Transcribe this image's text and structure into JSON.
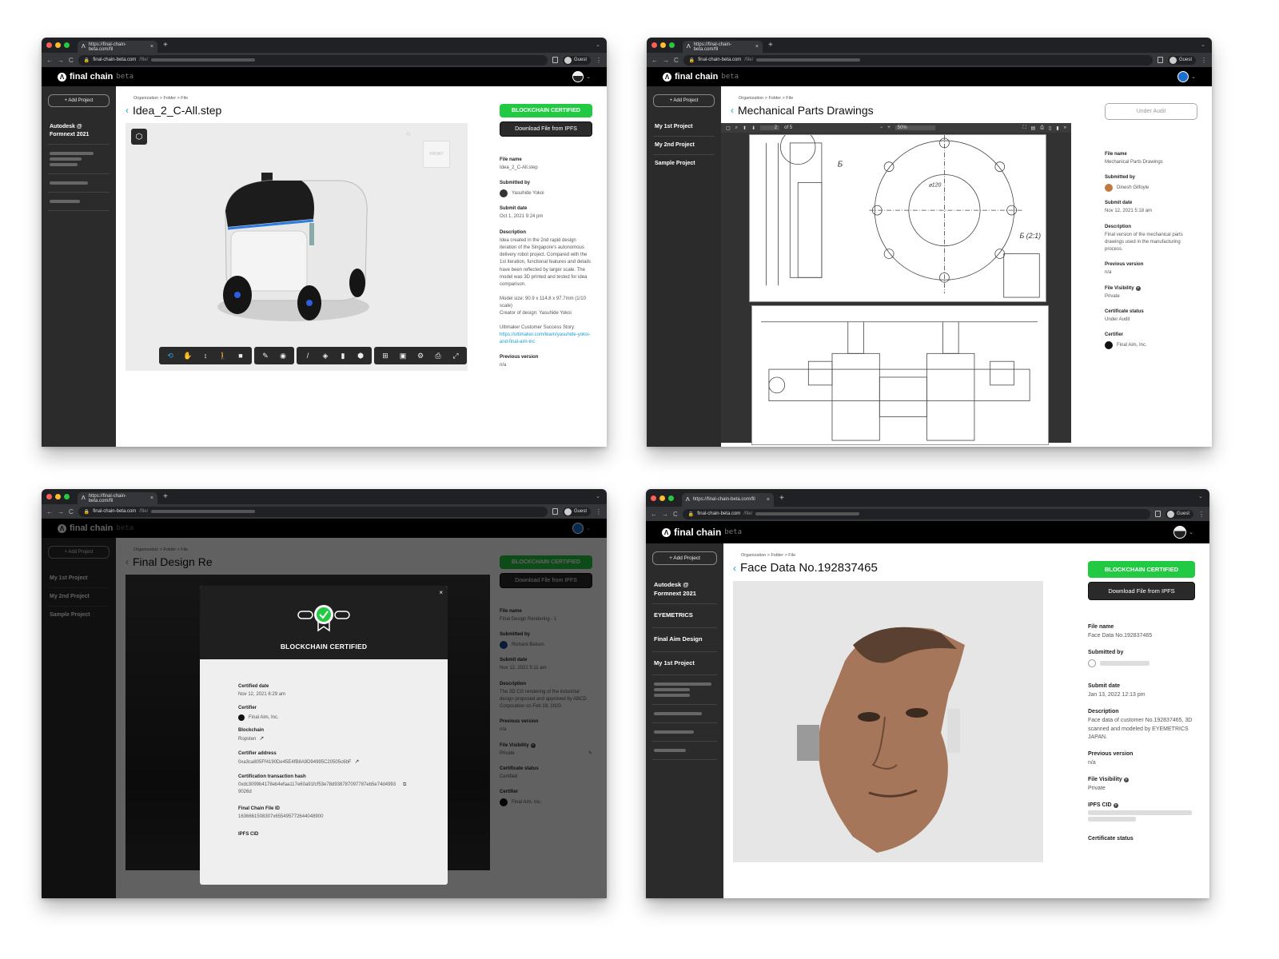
{
  "browser": {
    "tab_title": "https://final-chain-beta.com/fil",
    "url_host": "final-chain-beta.com",
    "url_path": "/file/",
    "profile_label": "Guest"
  },
  "app": {
    "brand": "final chain",
    "brand_suffix": "beta",
    "add_project_label": "+ Add Project",
    "breadcrumb": "Organization > Folder > File",
    "labels": {
      "file_name": "File name",
      "submitted_by": "Submitted by",
      "submit_date": "Submit date",
      "description": "Description",
      "previous_version": "Previous version",
      "file_visibility": "File Visibility",
      "certificate_status": "Certificate status",
      "certifier": "Certifier",
      "ipfs_cid": "IPFS CID"
    },
    "cert_button": "BLOCKCHAIN CERTIFIED",
    "download_button": "Download File from IPFS",
    "audit_button": "Under Audit"
  },
  "screens": [
    {
      "sidebar": [
        "Autodesk @ Formnext 2021"
      ],
      "title": "Idea_2_C-All.step",
      "file_name": "Idea_2_C-All.step",
      "submitted_by": "Yasuhide Yokoi",
      "submit_date": "Oct 1, 2021 9:24 pm",
      "description": "Idea created in the 2nd rapid design iteration of the Singapore's autonomous delivery robot project. Compared with the 1st iteration, functional features and details have been reflected by larger scale. The model was 3D printed and tested for idea comparison.",
      "description_extra": "Model size: 90.9 x 114.8 x 97.7mm (1/10 scale)",
      "creator": "Creator of design: Yasuhide Yokoi",
      "story_label": "Ultimaker Customer Success Story:",
      "story_link": "https://ultimaker.com/learn/yasuhide-yokoi-and-final-aim-inc",
      "previous_version": "n/a",
      "viewer_toolbar": [
        "orbit-icon",
        "pan-icon",
        "dolly-icon",
        "walk-icon",
        "camera-icon",
        "markup-icon",
        "visibility-icon",
        "measure-icon",
        "explode-icon",
        "section-icon",
        "model-browser-icon",
        "structure-icon",
        "properties-icon",
        "settings-icon",
        "print-icon",
        "fullscreen-icon"
      ]
    },
    {
      "sidebar": [
        "My 1st Project",
        "My 2nd Project",
        "Sample Project"
      ],
      "title": "Mechanical Parts Drawings",
      "pdf_page": "2",
      "pdf_pages": "of 5",
      "pdf_zoom": "50%",
      "file_name": "Mechanical Parts Drawings",
      "submitted_by": "Dinesh Gilfoyle",
      "submit_date": "Nov 12, 2021 5:18 am",
      "description": "Final version of the mechanical parts drawings used in the manufacturing process.",
      "previous_version": "n/a",
      "file_visibility": "Private",
      "certificate_status": "Under Audit",
      "certifier": "Final Aim, Inc."
    },
    {
      "sidebar": [
        "My 1st Project",
        "My 2nd Project",
        "Sample Project"
      ],
      "title": "Final Design Re",
      "file_name": "Final Design Rendering - 1",
      "submitted_by": "Richard Belson",
      "submit_date": "Nov 12, 2021 5:11 am",
      "description": "The 3D CG rendering of the industrial design proposed and approved by ABCD Corporation on Feb 19, 2020.",
      "previous_version": "n/a",
      "file_visibility": "Private",
      "certificate_status": "Certified",
      "certifier": "Final Aim, Inc.",
      "modal": {
        "title": "BLOCKCHAIN CERTIFIED",
        "close": "×",
        "fields": [
          {
            "label": "Certified date",
            "value": "Nov 12, 2021 6:29 am"
          },
          {
            "label": "Certifier",
            "value": "Final Aim, Inc."
          },
          {
            "label": "Blockchain",
            "value": "Ropsten"
          },
          {
            "label": "Certifier address",
            "value": "0xa3ca805Ff4190De45E4fB8A9D94995C20505c6bF"
          },
          {
            "label": "Certification transaction hash",
            "value": "0xdc3099b4178eb4efaa117e60a91fcf53e78d938787097787eb5e74d49939026d"
          },
          {
            "label": "Final Chain File ID",
            "value": "1636661508307x655495772644048900"
          },
          {
            "label": "IPFS CID",
            "value": ""
          }
        ]
      }
    },
    {
      "sidebar": [
        "Autodesk @ Formnext 2021",
        "EYEMETRICS",
        "Final Aim Design",
        "My 1st Project"
      ],
      "title": "Face Data No.192837465",
      "file_name": "Face Data No.192837465",
      "submit_date": "Jan 13, 2022 12:13 pm",
      "description": "Face data of customer No.192837465, 3D scanned and modeled by EYEMETRICS JAPAN.",
      "previous_version": "n/a",
      "file_visibility": "Private",
      "certificate_status_label": "Certificate status"
    }
  ]
}
